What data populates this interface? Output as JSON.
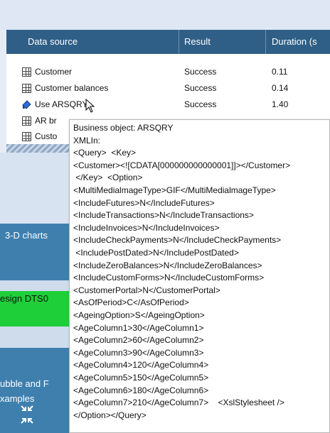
{
  "header": {
    "col_source": "Data source",
    "col_result": "Result",
    "col_duration": "Duration (s"
  },
  "rows": [
    {
      "icon": "table-icon",
      "name": "Customer",
      "result": "Success",
      "duration": "0.11"
    },
    {
      "icon": "table-icon",
      "name": "Customer balances",
      "result": "Success",
      "duration": "0.14"
    },
    {
      "icon": "business-object-icon",
      "name": "Use ARSQRY",
      "result": "Success",
      "duration": "1.40"
    },
    {
      "icon": "table-icon",
      "name": "AR br",
      "result": "",
      "duration": ""
    },
    {
      "icon": "table-icon",
      "name": "Custo",
      "result": "",
      "duration": ""
    }
  ],
  "tiles": {
    "three_d": "3-D charts",
    "design": "esign DTS0",
    "bubble_line1": "ubble and F",
    "bubble_line2": "xamples"
  },
  "tooltip": {
    "lines": [
      "Business object: ARSQRY",
      "XMLIn:",
      "<Query>  <Key>",
      "<Customer><![CDATA[000000000000001]]></Customer>",
      " </Key>  <Option>",
      "<MultiMedialmageType>GIF</MultiMedialmageType>",
      "<IncludeFutures>N</IncludeFutures>",
      "<IncludeTransactions>N</IncludeTransactions>",
      "<IncludeInvoices>N</IncludeInvoices>",
      "<IncludeCheckPayments>N</IncludeCheckPayments>",
      " <IncludePostDated>N</IncludePostDated>",
      "<IncludeZeroBalances>N</IncludeZeroBalances>",
      "<IncludeCustomForms>N</IncludeCustomForms>",
      "<CustomerPortal>N</CustomerPortal>",
      "<AsOfPeriod>C</AsOfPeriod>",
      "<AgeingOption>S</AgeingOption>",
      "<AgeColumn1>30</AgeColumn1>",
      "<AgeColumn2>60</AgeColumn2>",
      "<AgeColumn3>90</AgeColumn3>",
      "<AgeColumn4>120</AgeColumn4>",
      "<AgeColumn5>150</AgeColumn5>",
      "<AgeColumn6>180</AgeColumn6>",
      "<AgeColumn7>210</AgeColumn7>    <XslStylesheet />",
      "</Option></Query>"
    ]
  },
  "colors": {
    "header_bg": "#2f5f86",
    "tile_blue": "#3f7fae",
    "tile_green": "#1fcf3a"
  }
}
